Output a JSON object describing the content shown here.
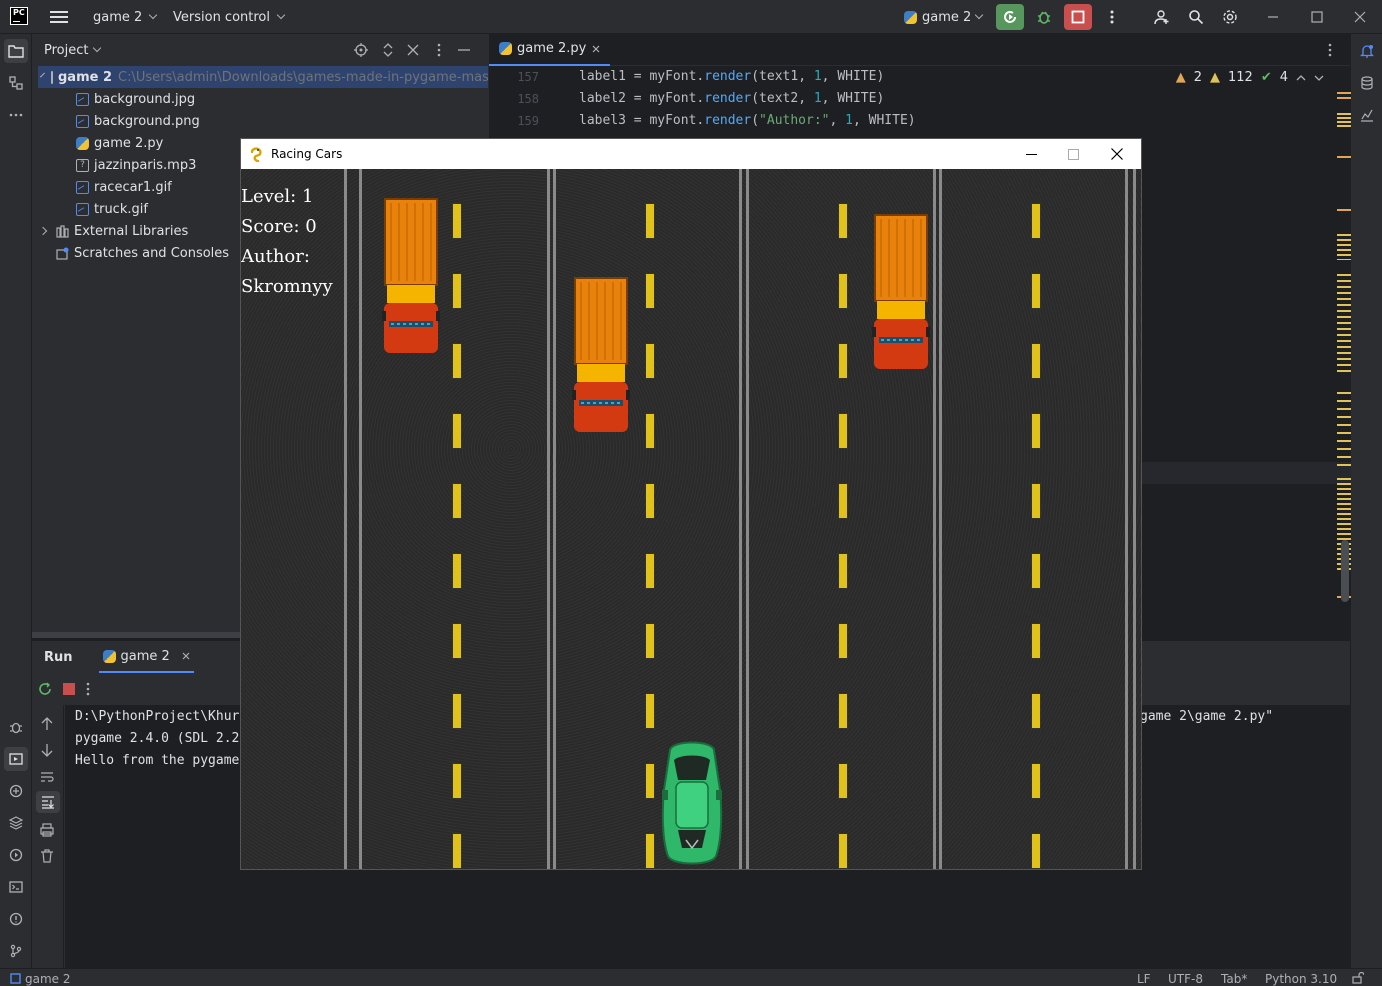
{
  "titlebar": {
    "project_name": "game 2",
    "vcs_label": "Version control",
    "run_config": "game 2"
  },
  "project_panel": {
    "title": "Project",
    "root_name": "game 2",
    "root_path": "C:\\Users\\admin\\Downloads\\games-made-in-pygame-mas",
    "files": [
      "background.jpg",
      "background.png",
      "game 2.py",
      "jazzinparis.mp3",
      "racecar1.gif",
      "truck.gif"
    ],
    "external_libraries": "External Libraries",
    "scratches": "Scratches and Consoles"
  },
  "editor": {
    "tab_name": "game 2.py",
    "lines": [
      {
        "num": "157",
        "var": "label1",
        "arg": "text1"
      },
      {
        "num": "158",
        "var": "label2",
        "arg": "text2"
      },
      {
        "num": "159",
        "var": "label3",
        "arg": "\"Author:\""
      }
    ],
    "inspections": {
      "errors": "2",
      "warnings": "112",
      "ok": "4"
    }
  },
  "run_panel": {
    "title": "Run",
    "tab_name": "game 2",
    "console_lines": [
      "D:\\PythonProject\\Khur",
      "pygame 2.4.0 (SDL 2.2",
      "Hello from the pygame"
    ],
    "console_tail": "game 2\\game 2.py\""
  },
  "statusbar": {
    "project": "game 2",
    "line_sep": "LF",
    "encoding": "UTF-8",
    "indent": "Tab*",
    "interpreter": "Python 3.10"
  },
  "game": {
    "window_title": "Racing Cars",
    "level_label": "Level:  1",
    "score_label": "Score:  0",
    "author_label": "Author:",
    "author_name": "Skromnyy"
  }
}
